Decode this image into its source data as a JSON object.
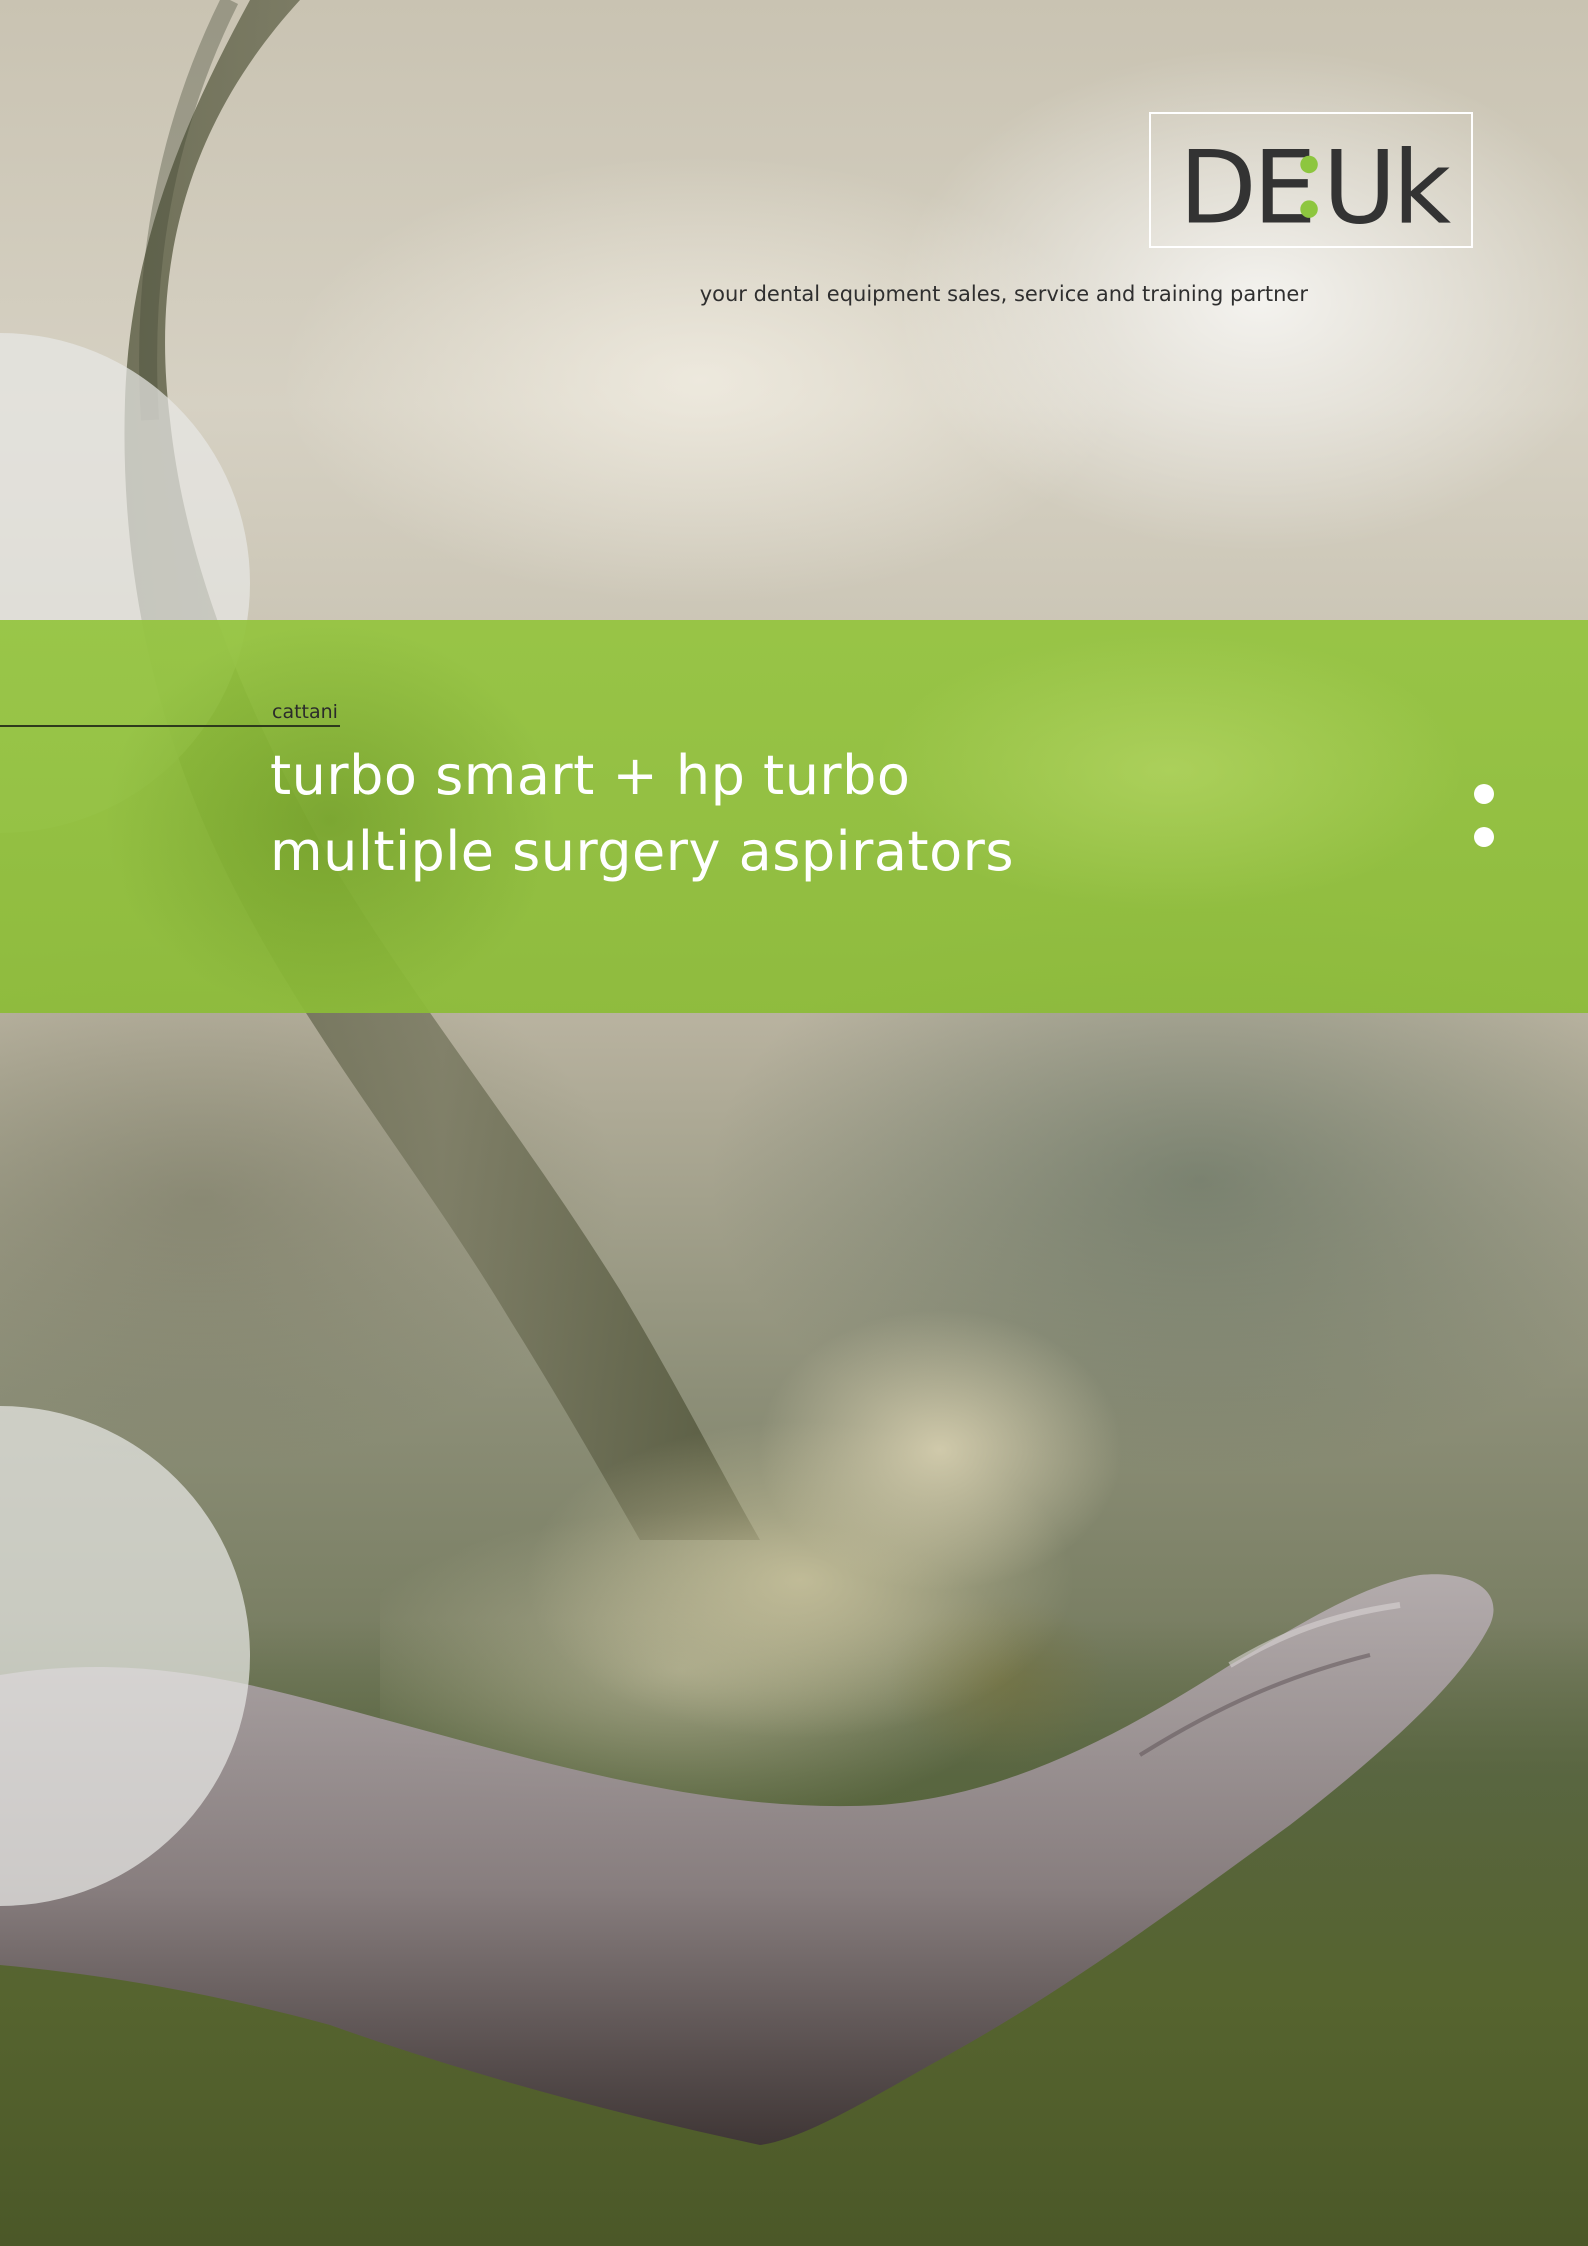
{
  "logo": {
    "text_left": "DE",
    "text_right": "Uk",
    "separator_color": "#8dc63f",
    "text_color": "#333333"
  },
  "tagline": "your dental equipment sales, service and training partner",
  "band": {
    "brand": "cattani",
    "title_line1": "turbo smart + hp turbo",
    "title_line2": "multiple surgery aspirators",
    "color": "#8dbe3c"
  },
  "icons": {
    "pager_dots": "pager-dots-icon"
  }
}
